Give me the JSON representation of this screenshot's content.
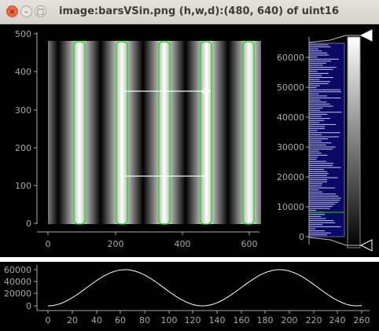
{
  "window": {
    "title": "image:barsVSin.png (h,w,d):(480, 640) of uint16",
    "close_glyph": "×",
    "minimize_glyph": "–",
    "maximize_glyph": "□"
  },
  "image_view": {
    "x_ticks": [
      "0",
      "200",
      "400",
      "600"
    ],
    "y_ticks": [
      "500",
      "400",
      "300",
      "200",
      "100",
      "0"
    ],
    "roi_count": 5
  },
  "histogram": {
    "y_ticks": [
      "60000",
      "50000",
      "40000",
      "30000",
      "20000",
      "10000",
      "0"
    ],
    "level_max": 65535,
    "level_min": 0,
    "marker_line_value": 8000
  },
  "profile": {
    "x_ticks": [
      "0",
      "20",
      "40",
      "60",
      "80",
      "100",
      "120",
      "140",
      "160",
      "180",
      "200",
      "220",
      "240",
      "260"
    ],
    "y_ticks": [
      "60000",
      "40000",
      "20000",
      "0"
    ]
  },
  "colors": {
    "roi": "#00e000",
    "roi_rect": "#ffffff",
    "hist_bg": "#0a0a66",
    "axis": "#a8a8a8"
  }
}
